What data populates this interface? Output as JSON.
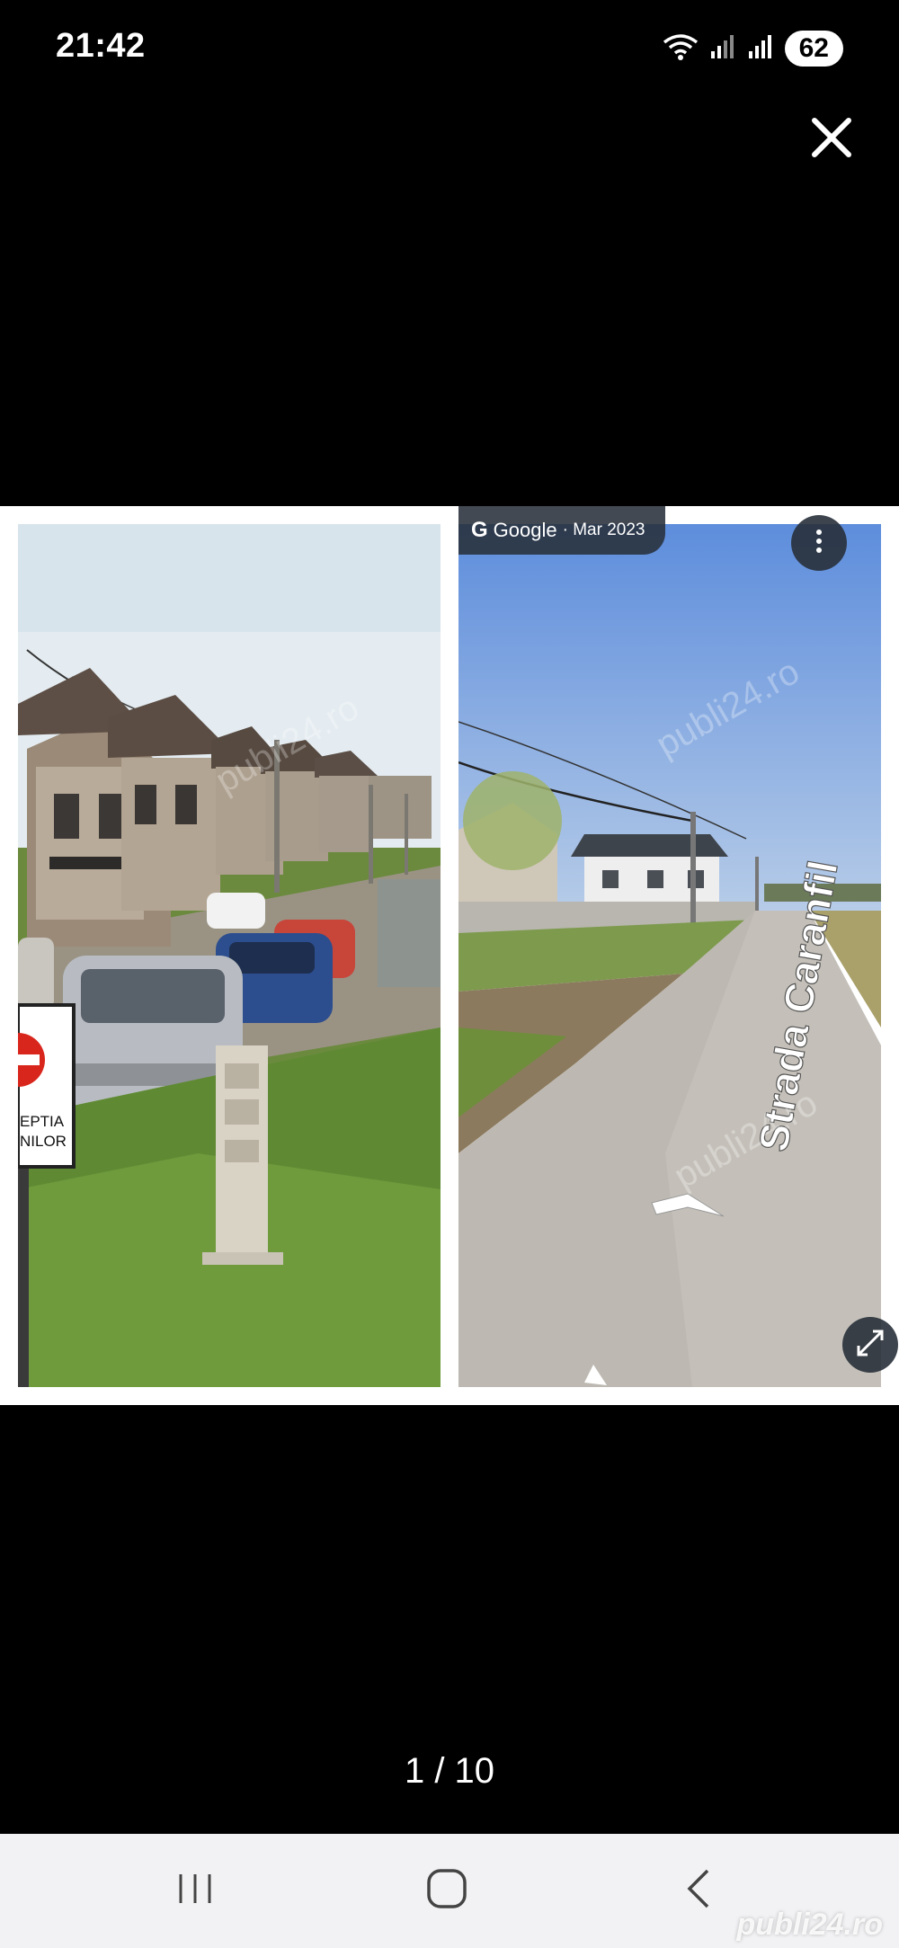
{
  "status_bar": {
    "time": "21:42",
    "battery": "62",
    "icons": [
      "wifi-icon",
      "signal-icon",
      "signal-icon"
    ]
  },
  "viewer": {
    "close_icon": "close-icon",
    "counter": "1 / 10",
    "photo_left": {
      "sign_text_line1": "EPTIA",
      "sign_text_line2": "NILOR",
      "watermark": "publi24.ro"
    },
    "photo_right": {
      "badge_logo": "G",
      "badge_brand": "Google",
      "badge_date": "· Mar 2023",
      "street_label": "Strada Caranfil",
      "watermark": "publi24.ro"
    }
  },
  "nav_bar": {
    "recents_icon": "recents-icon",
    "home_icon": "home-icon",
    "back_icon": "back-icon",
    "watermark": "publi24.ro"
  },
  "colors": {
    "background": "#000000",
    "nav_bar": "#f2f2f4",
    "badge": "#28303a",
    "sky_left": "#dfe8ef",
    "sky_right": "#6f9ae0"
  }
}
